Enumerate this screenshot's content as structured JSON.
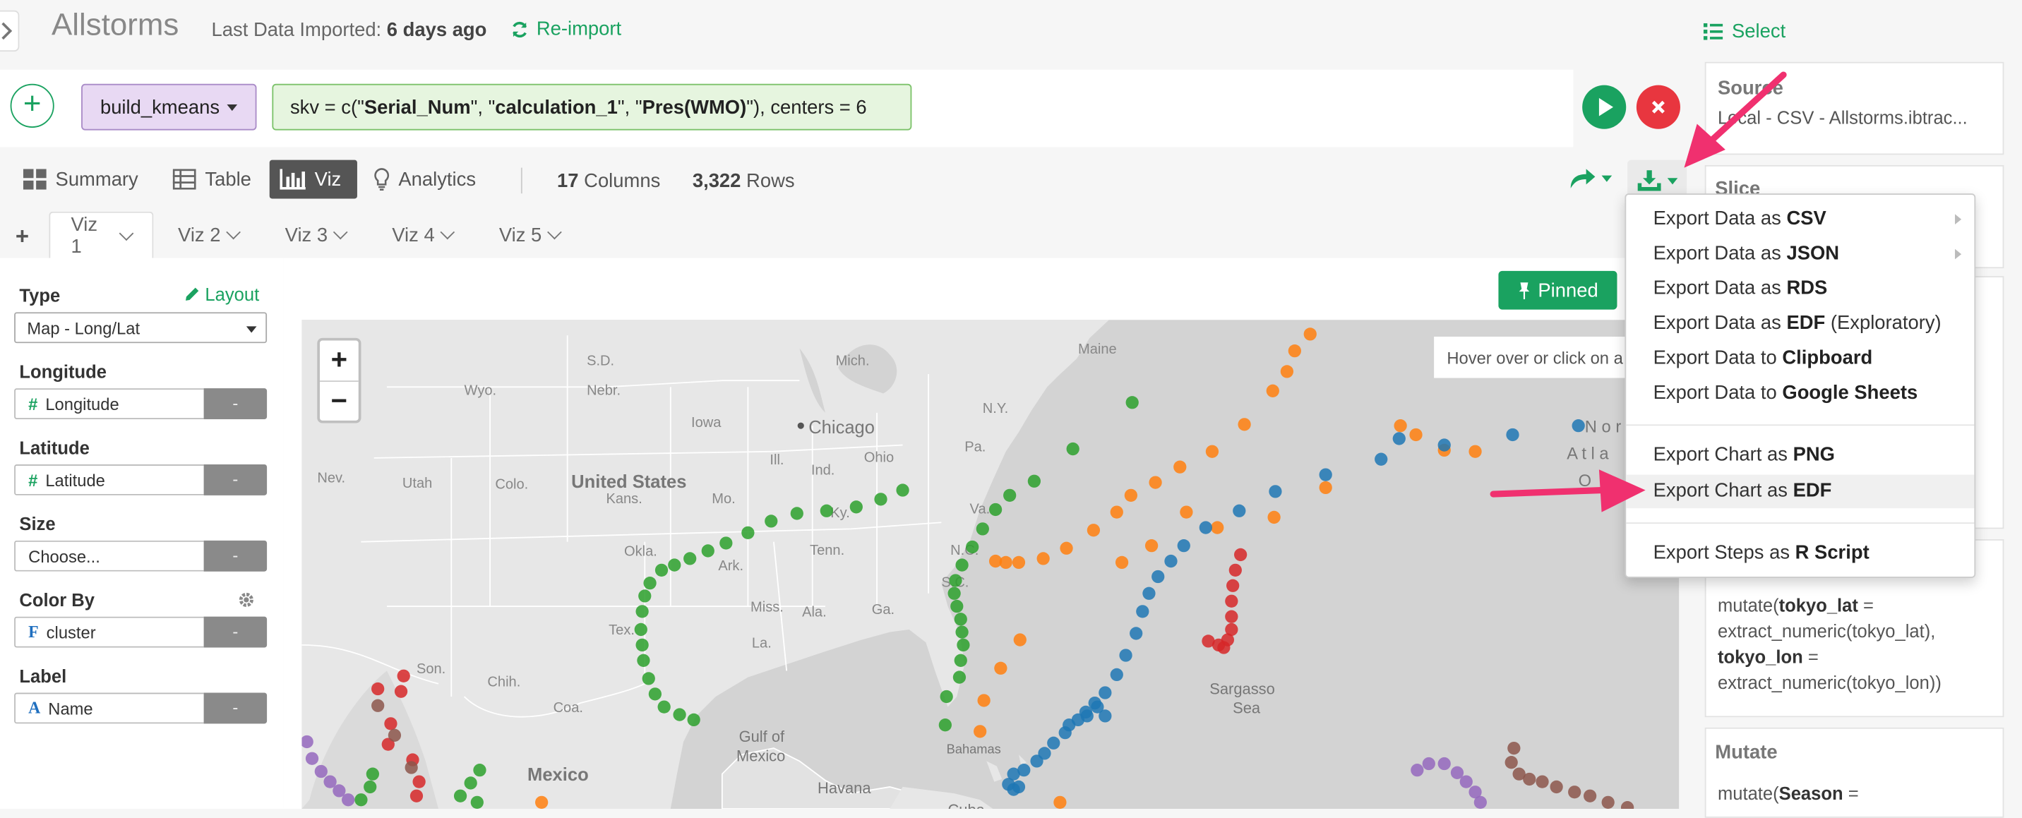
{
  "header": {
    "title": "Allstorms",
    "last_imported_label": "Last Data Imported:",
    "last_imported_value": "6 days ago",
    "reimport_label": "Re-import",
    "select_label": "Select"
  },
  "command": {
    "function_label": "build_kmeans",
    "code_prefix": "skv = c(\"",
    "arg1": "Serial_Num",
    "sep1": "\", \"",
    "arg2": "calculation_1",
    "sep2": "\", \"",
    "arg3": "Pres(WMO)",
    "code_suffix": "\"), centers = 6"
  },
  "view_tabs": {
    "summary": "Summary",
    "table": "Table",
    "viz": "Viz",
    "analytics": "Analytics",
    "active": "Viz"
  },
  "stats": {
    "columns_value": "17",
    "columns_label": "Columns",
    "rows_value": "3,322",
    "rows_label": "Rows"
  },
  "viz_tabs": [
    "Viz 1",
    "Viz 2",
    "Viz 3",
    "Viz 4",
    "Viz 5"
  ],
  "active_viz_tab": "Viz 1",
  "left_panel": {
    "type_label": "Type",
    "layout_label": "Layout",
    "type_value": "Map - Long/Lat",
    "longitude_label": "Longitude",
    "longitude_value": "Longitude",
    "latitude_label": "Latitude",
    "latitude_value": "Latitude",
    "size_label": "Size",
    "size_value": "Choose...",
    "color_label": "Color By",
    "color_value": "cluster",
    "label_label": "Label",
    "label_value": "Name",
    "minus": "-"
  },
  "map": {
    "pinned_label": "Pinned",
    "hover_hint": "Hover over or click on a",
    "zoom_in": "+",
    "zoom_out": "−",
    "labels": {
      "us": "United States",
      "chicago": "Chicago",
      "mexico": "Mexico",
      "gulf1": "Gulf of",
      "gulf2": "Mexico",
      "sargasso1": "Sargasso",
      "sargasso2": "Sea",
      "havana": "Havana",
      "bahamas": "Bahamas",
      "atl1": "N o r",
      "atl2": "A t l a",
      "atl3": "O",
      "cuba": "Cuba",
      "states": [
        "S.D.",
        "Maine",
        "Mich.",
        "Wyo.",
        "Nebr.",
        "Iowa",
        "N.Y.",
        "Ohio",
        "Ill.",
        "Ind.",
        "Pa.",
        "Nev.",
        "Utah",
        "Colo.",
        "Kans.",
        "Mo.",
        "Ky.",
        "Va.",
        "Okla.",
        "Ark.",
        "Tenn.",
        "N.C.",
        "S.C.",
        "Miss.",
        "Ala.",
        "Ga.",
        "Tex.",
        "La.",
        "Son.",
        "Chih.",
        "Coa."
      ]
    },
    "cluster_colors": {
      "green": "#2ca02c",
      "orange": "#ff7f0e",
      "blue": "#1f77b4",
      "red": "#d62728",
      "purple": "#9467bd",
      "brown": "#8c564b"
    }
  },
  "right_panel": {
    "source_title": "Source",
    "source_text": "Local - CSV - Allstorms.ibtrac...",
    "slice_title": "Slice",
    "mutate_code_1": "mutate(",
    "mutate_code_b1": "tokyo_lat",
    "mutate_code_2": " =",
    "mutate_code_3": "extract_numeric(tokyo_lat),",
    "mutate_code_b2": "tokyo_lon",
    "mutate_code_4": " =",
    "mutate_code_5": "extract_numeric(tokyo_lon))",
    "mutate_title": "Mutate",
    "mutate2_code_1": "mutate(",
    "mutate2_code_b": "Season",
    "mutate2_code_2": " ="
  },
  "export_menu": {
    "items": [
      {
        "prefix": "Export Data as ",
        "bold": "CSV",
        "suffix": "",
        "submenu": true
      },
      {
        "prefix": "Export Data as ",
        "bold": "JSON",
        "suffix": "",
        "submenu": true
      },
      {
        "prefix": "Export Data as ",
        "bold": "RDS",
        "suffix": ""
      },
      {
        "prefix": "Export Data as ",
        "bold": "EDF",
        "suffix": " (Exploratory)"
      },
      {
        "prefix": "Export Data to ",
        "bold": "Clipboard",
        "suffix": ""
      },
      {
        "prefix": "Export Data to ",
        "bold": "Google Sheets",
        "suffix": ""
      },
      {
        "prefix": "Export Chart as ",
        "bold": "PNG",
        "suffix": ""
      },
      {
        "prefix": "Export Chart as ",
        "bold": "EDF",
        "suffix": "",
        "highlighted": true
      },
      {
        "prefix": "Export Steps as ",
        "bold": "R Script",
        "suffix": ""
      }
    ]
  },
  "colors": {
    "accent_green": "#1aa260",
    "cancel_red": "#e8363f",
    "annotation_pink": "#f0306f"
  }
}
